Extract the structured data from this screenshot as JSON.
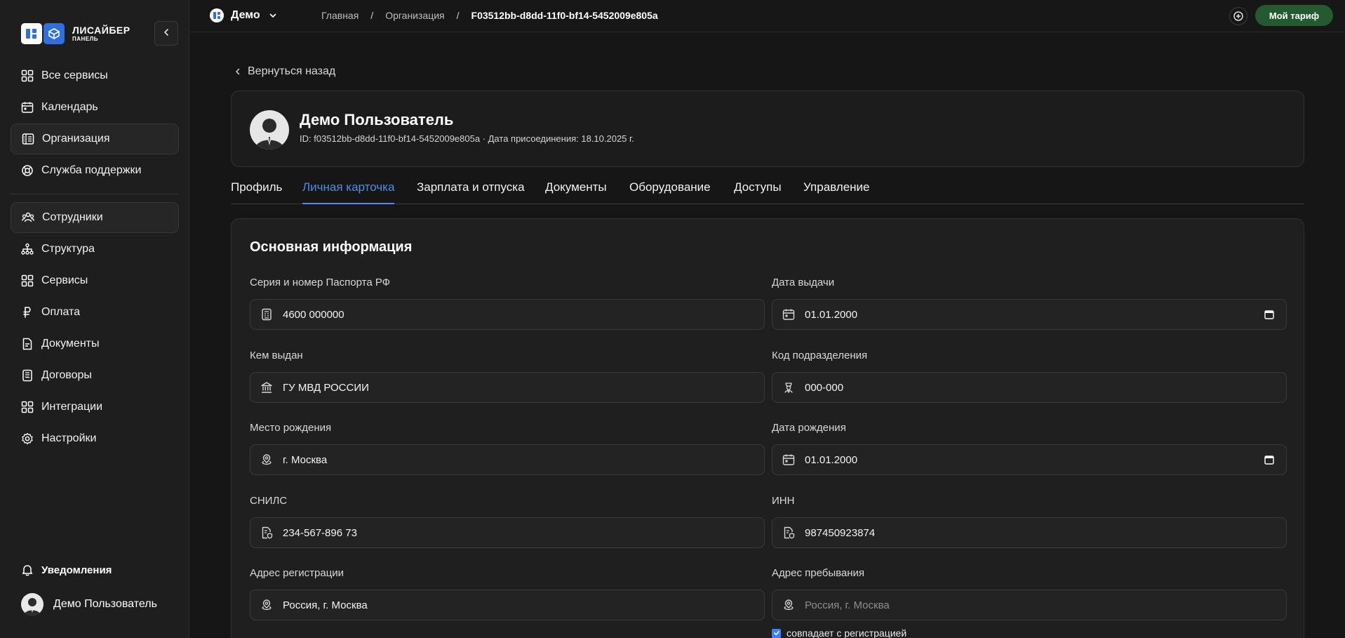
{
  "sidebar": {
    "logo": {
      "title": "ЛИСАЙБЕР",
      "subtitle": "ПАНЕЛЬ"
    },
    "items_top": [
      {
        "label": "Все сервисы",
        "icon": "grid-icon"
      },
      {
        "label": "Календарь",
        "icon": "calendar-icon"
      },
      {
        "label": "Организация",
        "icon": "organization-icon",
        "active": true
      },
      {
        "label": "Служба поддержки",
        "icon": "lifebuoy-icon"
      }
    ],
    "items_bottom": [
      {
        "label": "Сотрудники",
        "icon": "users-icon",
        "active": true
      },
      {
        "label": "Структура",
        "icon": "hierarchy-icon"
      },
      {
        "label": "Сервисы",
        "icon": "grid-icon"
      },
      {
        "label": "Оплата",
        "icon": "ruble-icon"
      },
      {
        "label": "Документы",
        "icon": "document-icon"
      },
      {
        "label": "Договоры",
        "icon": "contract-icon"
      },
      {
        "label": "Интеграции",
        "icon": "grid-icon"
      },
      {
        "label": "Настройки",
        "icon": "gear-icon"
      }
    ],
    "notifications_label": "Уведомления",
    "user_name": "Демо Пользователь"
  },
  "topbar": {
    "org_name": "Демо",
    "breadcrumb": [
      "Главная",
      "Организация",
      "F03512bb-d8dd-11f0-bf14-5452009e805a"
    ],
    "breadcrumb_sep": "/",
    "tariff_label": "Мой тариф"
  },
  "main": {
    "back_label": "Вернуться назад",
    "profile": {
      "name": "Демо Пользователь",
      "meta": "ID: f03512bb-d8dd-11f0-bf14-5452009e805a · Дата присоединения: 18.10.2025 г."
    },
    "tabs": [
      "Профиль",
      "Личная карточка",
      "Зарплата и отпуска",
      "Документы",
      "Оборудование",
      "Доступы",
      "Управление"
    ],
    "active_tab": "Личная карточка",
    "form": {
      "title": "Основная информация",
      "fields": {
        "passport": {
          "label": "Серия и номер Паспорта РФ",
          "value": "4600 000000",
          "icon": "passport-icon"
        },
        "issue_date": {
          "label": "Дата выдачи",
          "value": "01.01.2000",
          "icon": "calendar-icon"
        },
        "issued_by": {
          "label": "Кем выдан",
          "value": "ГУ МВД РОССИИ",
          "icon": "bank-icon"
        },
        "dept_code": {
          "label": "Код подразделения",
          "value": "000-000",
          "icon": "badge-icon"
        },
        "birth_place": {
          "label": "Место рождения",
          "value": "г. Москва",
          "icon": "location-icon"
        },
        "birth_date": {
          "label": "Дата рождения",
          "value": "01.01.2000",
          "icon": "calendar-icon"
        },
        "snils": {
          "label": "СНИЛС",
          "value": "234-567-896 73",
          "icon": "document-shield-icon"
        },
        "inn": {
          "label": "ИНН",
          "value": "987450923874",
          "icon": "document-shield-icon"
        },
        "reg_address": {
          "label": "Адрес регистрации",
          "value": "Россия, г. Москва",
          "icon": "location-icon"
        },
        "stay_address": {
          "label": "Адрес пребывания",
          "placeholder": "Россия, г. Москва",
          "icon": "location-icon"
        }
      },
      "same_as_reg_label": "совпадает с регистрацией",
      "same_as_reg_checked": true
    }
  },
  "colors": {
    "accent": "#4d8af0",
    "tariff_bg": "#235a2e",
    "logo_blue": "#2f6fe0"
  }
}
